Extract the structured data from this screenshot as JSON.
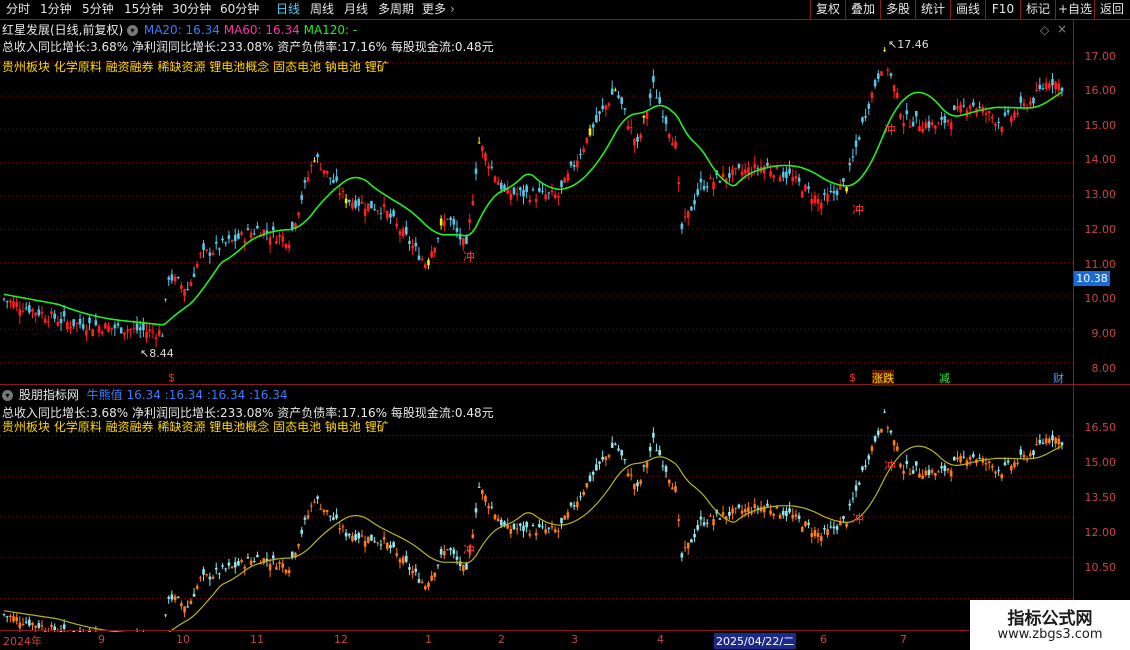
{
  "toolbar": {
    "tabs": [
      {
        "label": "分时"
      },
      {
        "label": "1分钟"
      },
      {
        "label": "5分钟"
      },
      {
        "label": "15分钟"
      },
      {
        "label": "30分钟"
      },
      {
        "label": "60分钟"
      },
      {
        "label": "日线",
        "active": true
      },
      {
        "label": "周线"
      },
      {
        "label": "月线"
      },
      {
        "label": "多周期"
      },
      {
        "label": "更多"
      }
    ],
    "right_buttons": [
      {
        "label": "复权"
      },
      {
        "label": "叠加"
      },
      {
        "label": "多股"
      },
      {
        "label": "统计"
      },
      {
        "label": "画线"
      },
      {
        "label": "F10"
      },
      {
        "label": "标记"
      },
      {
        "label": "+自选"
      },
      {
        "label": "返回"
      }
    ]
  },
  "main_pane": {
    "title": "红星发展(日线,前复权)",
    "ma20": "MA20: 16.34",
    "ma60": "MA60: 16.34",
    "ma120": "MA120: -",
    "info": "总收入同比增长:3.68%  净利润同比增长:233.08%  资产负债率:17.16%  每股现金流:0.48元",
    "concepts": "贵州板块  化学原料  融资融券   稀缺资源  锂电池概念  固态电池  钠电池  锂矿",
    "y_labels": [
      "17.00",
      "16.00",
      "15.00",
      "14.00",
      "13.00",
      "12.00",
      "11.00",
      "10.00",
      "9.00",
      "8.00"
    ],
    "price_tag": "10.38",
    "high_label": "17.46",
    "low_label": "8.44",
    "chong": "冲",
    "markers": {
      "s": "$",
      "tag1": "涨跌",
      "tag2": "减",
      "tag3": "财"
    }
  },
  "sub_pane": {
    "title": "股朋指标网",
    "values": "牛熊值  16.34  :16.34  :16.34  :16.34",
    "info": "总收入同比增长:3.68%  净利润同比增长:233.08%  资产负债率:17.16%  每股现金流:0.48元",
    "concepts": "贵州板块  化学原料  融资融券   稀缺资源  锂电池概念  固态电池  钠电池  锂矿",
    "y_labels": [
      "16.50",
      "15.00",
      "13.50",
      "12.00",
      "10.50"
    ],
    "chong": "冲"
  },
  "date_axis": {
    "labels": [
      "2024年",
      "9",
      "10",
      "11",
      "12",
      "1",
      "2",
      "3",
      "4",
      "2025/04/22/二",
      "6",
      "7"
    ]
  },
  "watermark": {
    "line1": "指标公式网",
    "line2": "www.zbgs3.com"
  },
  "colors": {
    "up": "#ff2020",
    "down": "#54c8e8",
    "ma_green": "#22ee22",
    "ma_magenta": "#ff33aa",
    "yellow_bar": "#ffee00",
    "grid": "#7a1010"
  },
  "chart_data": {
    "type": "candlestick",
    "ylim_main": [
      7.6,
      17.8
    ],
    "ylim_sub": [
      9.6,
      17.4
    ],
    "approx_close_path": [
      {
        "i": 0,
        "p": 9.9
      },
      {
        "i": 20,
        "p": 9.2
      },
      {
        "i": 40,
        "p": 9.0
      },
      {
        "i": 50,
        "p": 8.9
      },
      {
        "i": 52,
        "p": 10.6
      },
      {
        "i": 58,
        "p": 10.2
      },
      {
        "i": 62,
        "p": 11.2
      },
      {
        "i": 80,
        "p": 12.0
      },
      {
        "i": 90,
        "p": 11.7
      },
      {
        "i": 98,
        "p": 14.2
      },
      {
        "i": 108,
        "p": 12.9
      },
      {
        "i": 120,
        "p": 12.6
      },
      {
        "i": 133,
        "p": 11.0
      },
      {
        "i": 140,
        "p": 12.4
      },
      {
        "i": 146,
        "p": 11.4
      },
      {
        "i": 150,
        "p": 14.6
      },
      {
        "i": 158,
        "p": 13.1
      },
      {
        "i": 175,
        "p": 13.0
      },
      {
        "i": 185,
        "p": 14.9
      },
      {
        "i": 193,
        "p": 16.2
      },
      {
        "i": 200,
        "p": 14.5
      },
      {
        "i": 205,
        "p": 16.3
      },
      {
        "i": 212,
        "p": 14.5
      },
      {
        "i": 214,
        "p": 12.0
      },
      {
        "i": 220,
        "p": 13.3
      },
      {
        "i": 228,
        "p": 13.6
      },
      {
        "i": 240,
        "p": 13.9
      },
      {
        "i": 248,
        "p": 13.6
      },
      {
        "i": 258,
        "p": 12.8
      },
      {
        "i": 266,
        "p": 13.4
      },
      {
        "i": 272,
        "p": 15.5
      },
      {
        "i": 278,
        "p": 17.2
      },
      {
        "i": 284,
        "p": 15.3
      },
      {
        "i": 295,
        "p": 15.1
      },
      {
        "i": 305,
        "p": 15.8
      },
      {
        "i": 315,
        "p": 15.2
      },
      {
        "i": 325,
        "p": 15.9
      },
      {
        "i": 330,
        "p": 16.5
      },
      {
        "i": 334,
        "p": 16.3
      }
    ]
  }
}
